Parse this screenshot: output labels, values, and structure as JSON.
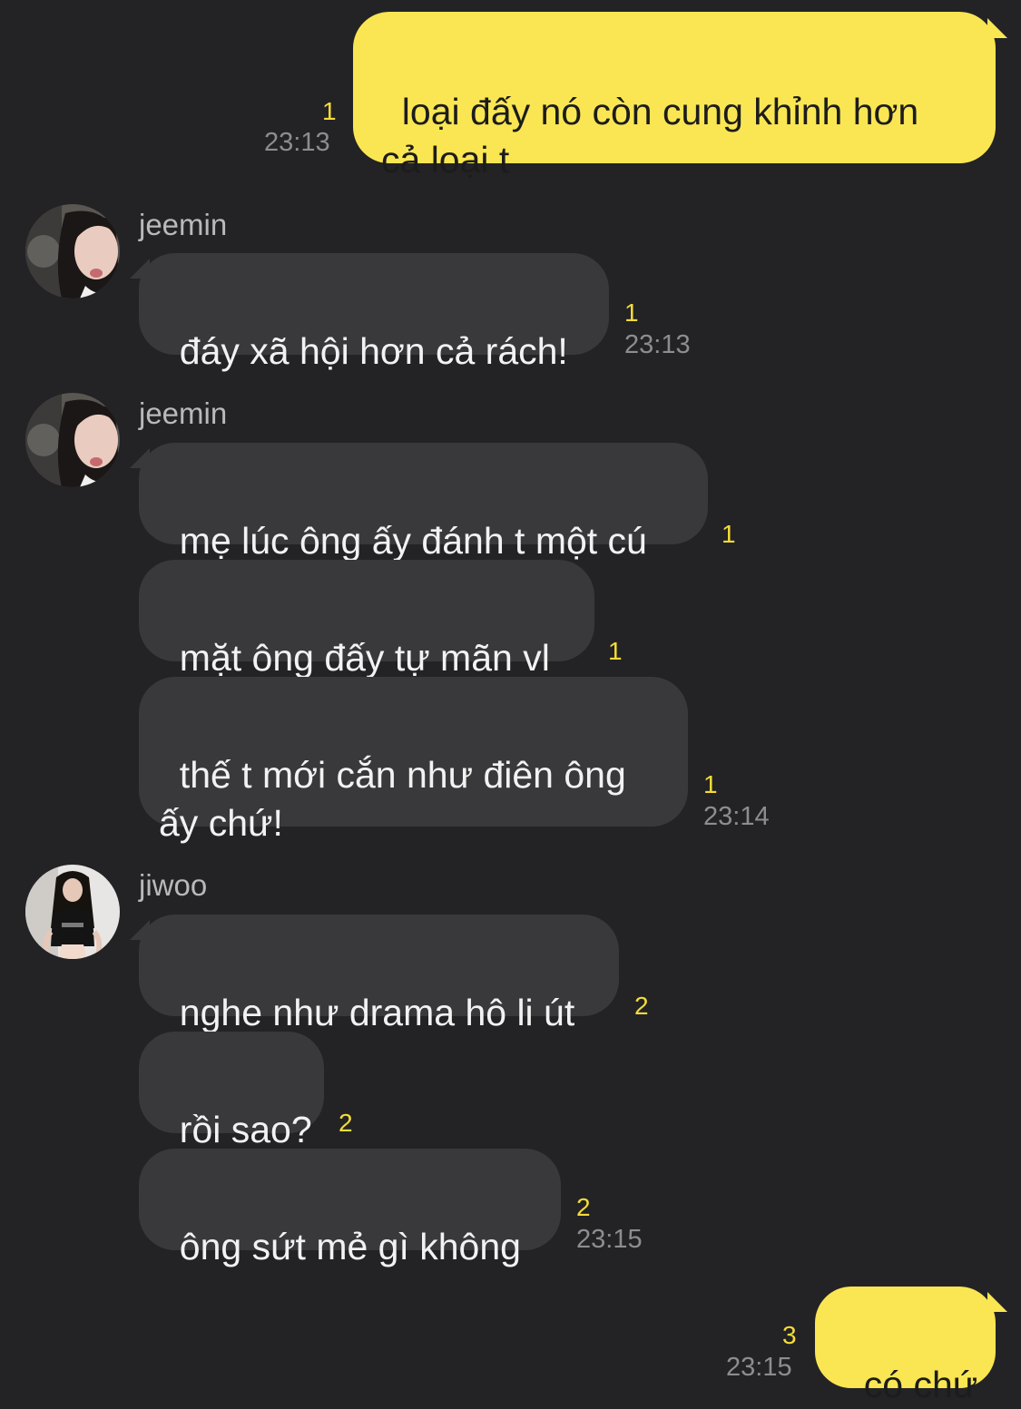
{
  "colors": {
    "background": "#232325",
    "outgoing_bubble": "#fae652",
    "incoming_bubble": "#39393b",
    "unread_count": "#f4dc3a",
    "timestamp": "#8d8d91"
  },
  "messages": {
    "m1": {
      "text": "loại đấy nó còn cung khỉnh hơn\ncả loại t",
      "unread": "1",
      "time": "23:13"
    },
    "g1": {
      "sender": "jeemin"
    },
    "m2": {
      "text": "đáy xã hội hơn cả rách!",
      "unread": "1",
      "time": "23:13"
    },
    "g2": {
      "sender": "jeemin"
    },
    "m3": {
      "text": "mẹ lúc ông ấy đánh t một cú",
      "unread": "1"
    },
    "m4": {
      "text": "mặt ông đấy tự mãn vl",
      "unread": "1"
    },
    "m5": {
      "text": "thế t mới cắn như điên ông\nấy chứ!",
      "unread": "1",
      "time": "23:14"
    },
    "g3": {
      "sender": "jiwoo"
    },
    "m6": {
      "text": "nghe như drama hô li út",
      "unread": "2"
    },
    "m7": {
      "text": "rồi sao?",
      "unread": "2"
    },
    "m8": {
      "text": "ông sứt mẻ gì không",
      "unread": "2",
      "time": "23:15"
    },
    "m9": {
      "text": "có chứ",
      "unread": "3",
      "time": "23:15"
    }
  },
  "icons": {
    "jeemin_avatar": "avatar-photo-icon",
    "jiwoo_avatar": "avatar-photo-icon"
  }
}
